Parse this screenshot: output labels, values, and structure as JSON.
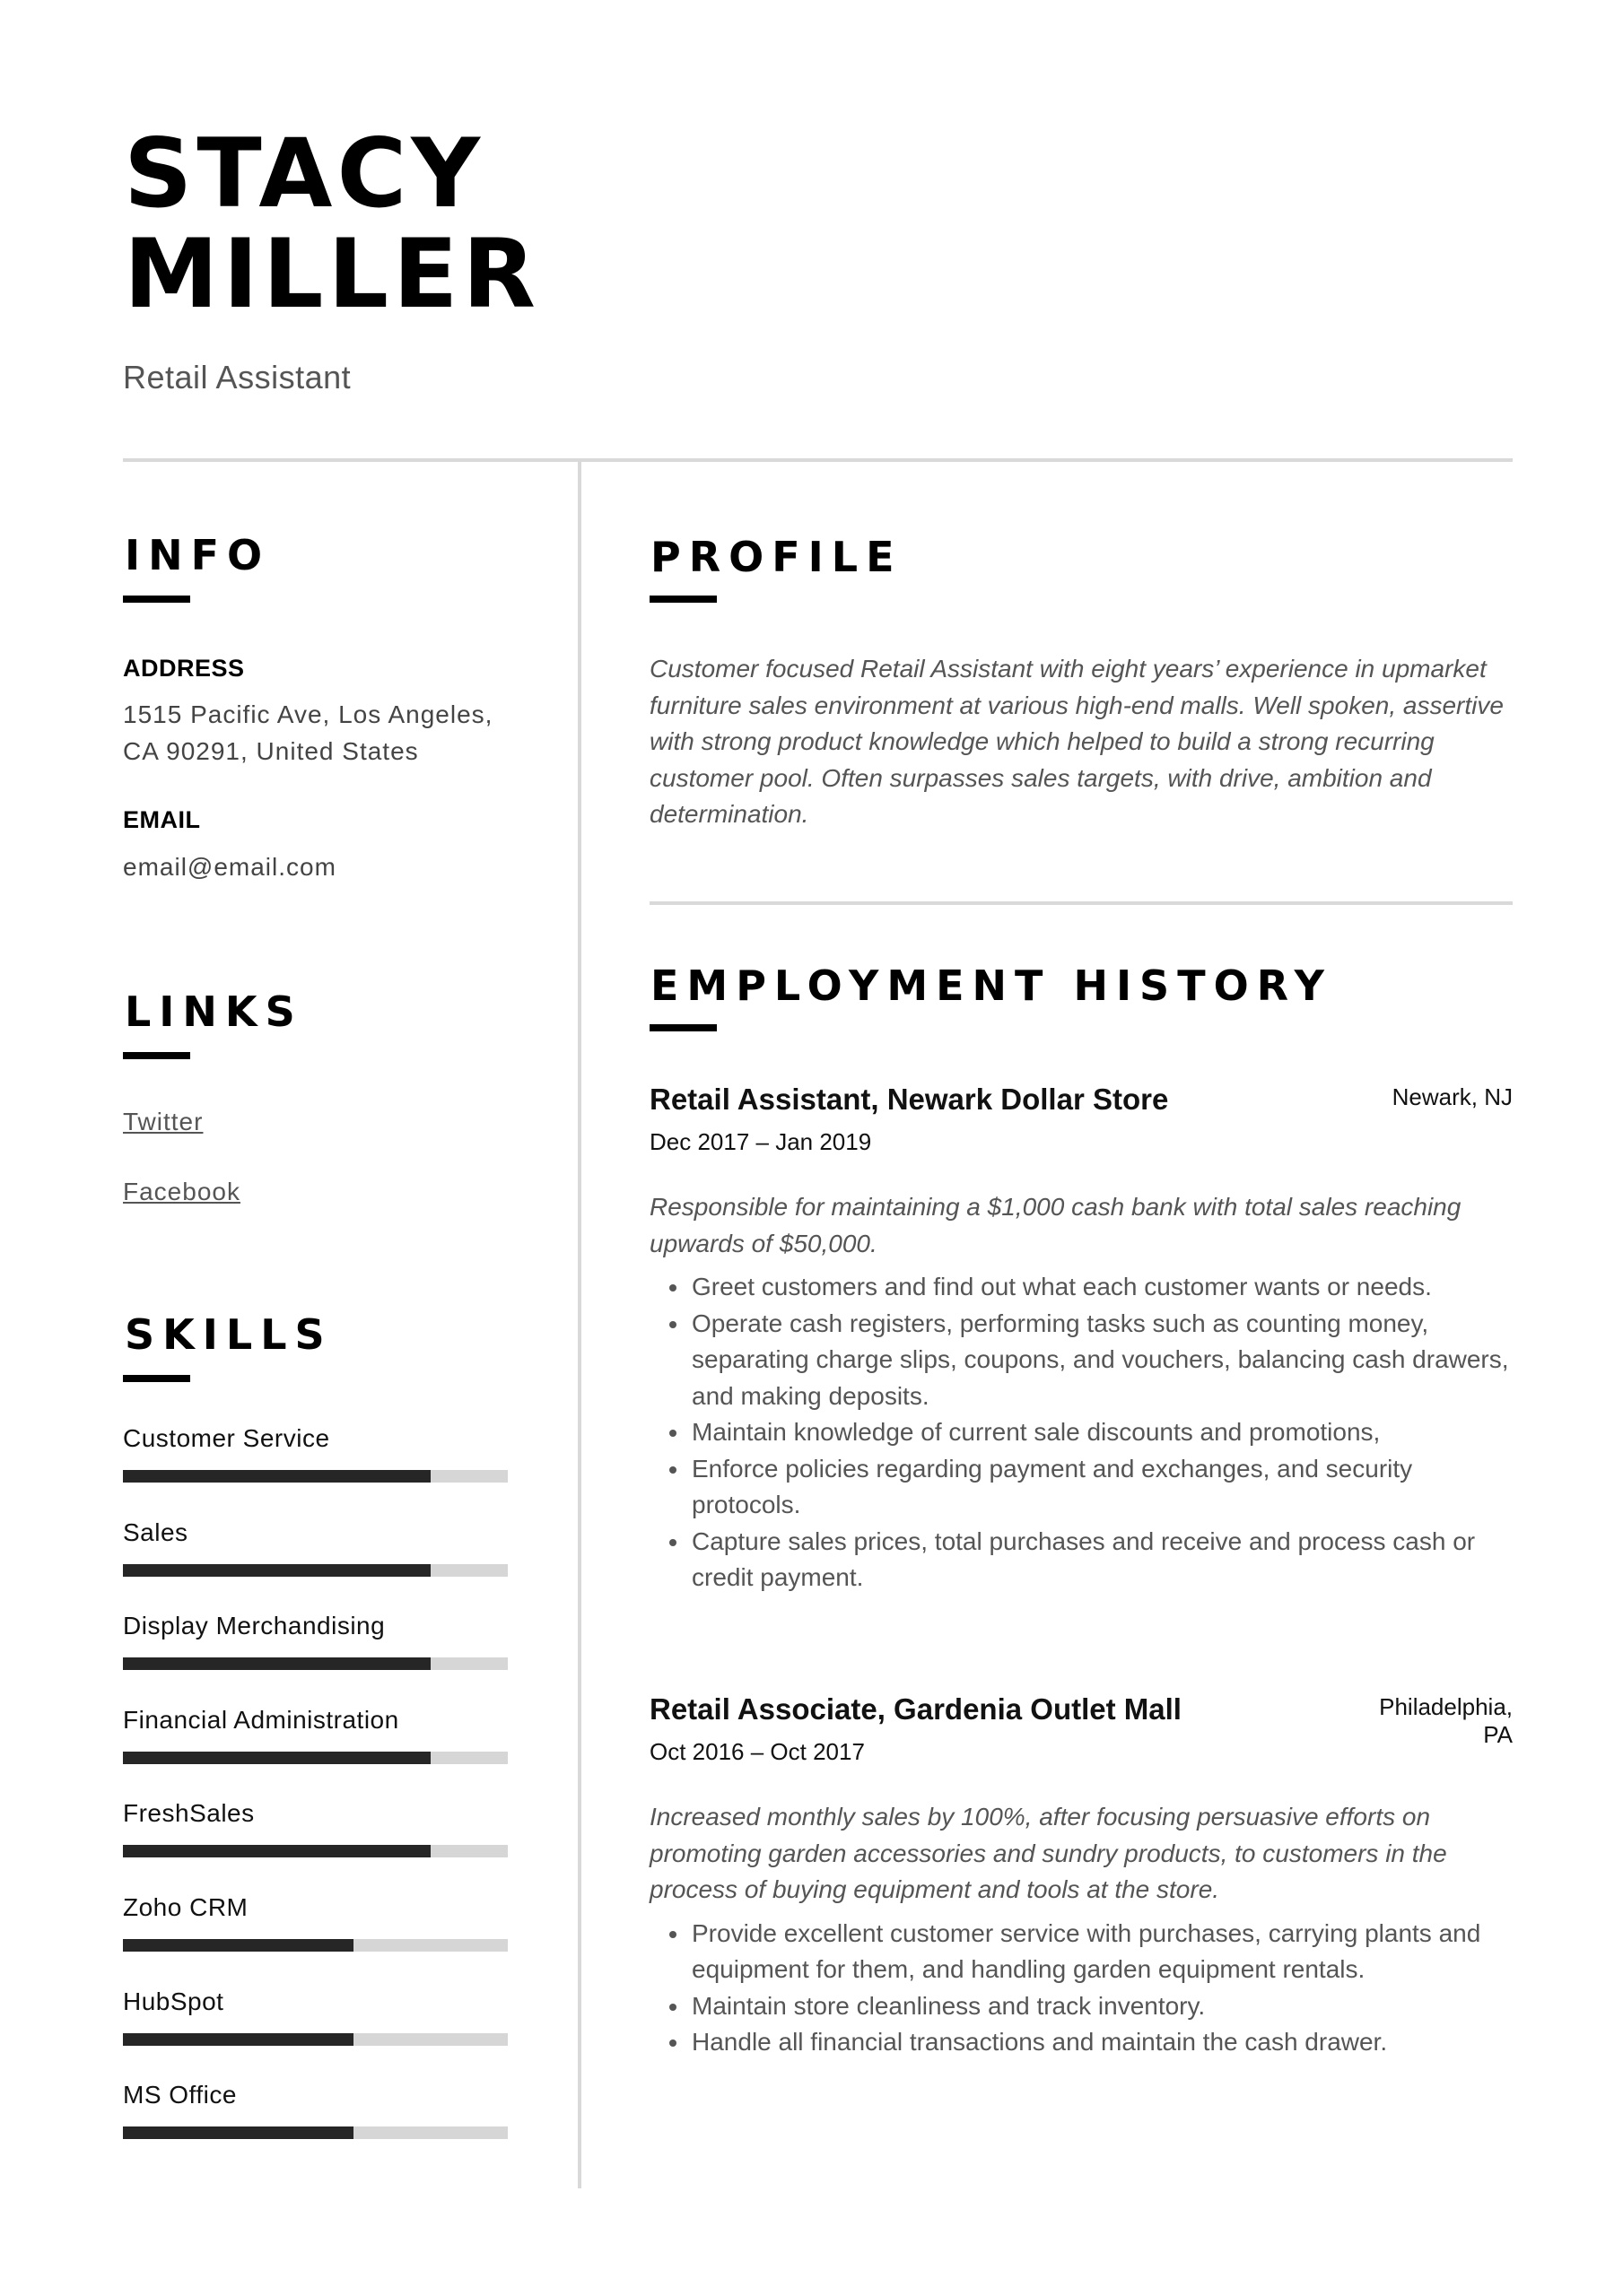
{
  "header": {
    "first_name": "STACY",
    "last_name": "MILLER",
    "job_title": "Retail Assistant"
  },
  "info": {
    "heading": "INFO",
    "address_label": "ADDRESS",
    "address_line1": "1515 Pacific Ave, Los Angeles,",
    "address_line2": "CA 90291, United States",
    "email_label": "EMAIL",
    "email": "email@email.com"
  },
  "links": {
    "heading": "LINKS",
    "items": [
      {
        "label": "Twitter"
      },
      {
        "label": "Facebook"
      }
    ]
  },
  "skills": {
    "heading": "SKILLS",
    "items": [
      {
        "name": "Customer Service",
        "level": 0.8
      },
      {
        "name": "Sales",
        "level": 0.8
      },
      {
        "name": "Display Merchandising",
        "level": 0.8
      },
      {
        "name": "Financial Administration",
        "level": 0.8
      },
      {
        "name": "FreshSales",
        "level": 0.8
      },
      {
        "name": "Zoho CRM",
        "level": 0.6
      },
      {
        "name": "HubSpot",
        "level": 0.6
      },
      {
        "name": "MS Office",
        "level": 0.6
      }
    ]
  },
  "profile": {
    "heading": "PROFILE",
    "text": "Customer focused Retail Assistant with eight years’ experience in upmarket furniture sales environment at various high-end malls. Well spoken, assertive with strong product knowledge which helped to build a strong recurring customer pool. Often surpasses sales targets, with drive, ambition and determination."
  },
  "employment": {
    "heading": "EMPLOYMENT HISTORY",
    "jobs": [
      {
        "title": "Retail Assistant, Newark Dollar Store",
        "location_line1": "Newark, NJ",
        "location_line2": "",
        "dates": "Dec 2017 – Jan 2019",
        "summary": "Responsible for maintaining a $1,000 cash bank with total sales reaching upwards of $50,000.",
        "bullets": [
          "Greet customers and find out what each customer wants or needs.",
          "Operate cash registers, performing tasks such as counting money, separating charge slips, coupons, and vouchers, balancing cash drawers, and making deposits.",
          "Maintain knowledge of current sale discounts and promotions,",
          "Enforce policies regarding payment and exchanges, and security protocols.",
          "Capture sales prices, total purchases and receive and process cash or credit payment."
        ]
      },
      {
        "title": "Retail Associate, Gardenia Outlet Mall",
        "location_line1": "Philadelphia,",
        "location_line2": "PA",
        "dates": "Oct 2016 – Oct 2017",
        "summary": "Increased monthly sales by 100%, after focusing persuasive efforts on promoting garden accessories and sundry products, to customers in the process of buying equipment and tools at the store.",
        "bullets": [
          "Provide excellent customer service with purchases, carrying plants and equipment for them, and handling garden equipment rentals.",
          "Maintain store cleanliness and track inventory.",
          "Handle all financial transactions and maintain the cash drawer."
        ]
      }
    ]
  }
}
